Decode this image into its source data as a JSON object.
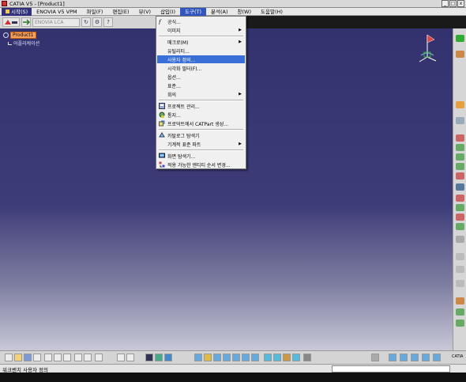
{
  "window": {
    "title": "CATIA V5 - [Product1]",
    "buttons": [
      "_",
      "□",
      "x"
    ]
  },
  "menubar": {
    "items": [
      "시작(S)",
      "ENOVIA V5 VPM",
      "파일(F)",
      "편집(E)",
      "뷰(V)",
      "삽입(I)",
      "도구(T)",
      "분석(A)",
      "창(W)",
      "도움말(H)"
    ]
  },
  "toolbar": {
    "field_placeholder": "ENOVIA LCA"
  },
  "tree": {
    "root_label": "Product1",
    "child_label": "어플리케이션"
  },
  "tools_menu": {
    "items": [
      {
        "label": "공식...",
        "icon": "formula-icon"
      },
      {
        "label": "이미지",
        "submenu": true
      },
      {
        "label": "매크로(M)",
        "submenu": true
      },
      {
        "label": "유틸리티..."
      },
      {
        "label": "사용자 정의...",
        "selected": true
      },
      {
        "label": "시각화 필터(F)..."
      },
      {
        "label": "옵션..."
      },
      {
        "label": "표준..."
      },
      {
        "label": "회의",
        "submenu": true
      },
      {
        "label": "프로젝트 관리...",
        "icon": "project-icon"
      },
      {
        "label": "통지...",
        "icon": "notify-icon"
      },
      {
        "label": "프로덕트에서 CATPart 생성...",
        "icon": "catpart-icon"
      },
      {
        "label": "카탈로그 탐색기",
        "icon": "catalog-icon"
      },
      {
        "label": "기계적 표준 파트",
        "submenu": true
      },
      {
        "label": "화면 탐색기...",
        "icon": "screen-icon"
      },
      {
        "label": "적용 가능한 엔티티 순서 변경...",
        "icon": "reorder-icon"
      }
    ]
  },
  "status": {
    "message": "워크벤치 사용자 정의"
  },
  "colors": {
    "viewport_top": "#34326e",
    "viewport_bottom": "#c8c8d8",
    "selection": "#3a6fd8",
    "tree_highlight": "#f6a15b"
  },
  "logo_text": "CATIA"
}
